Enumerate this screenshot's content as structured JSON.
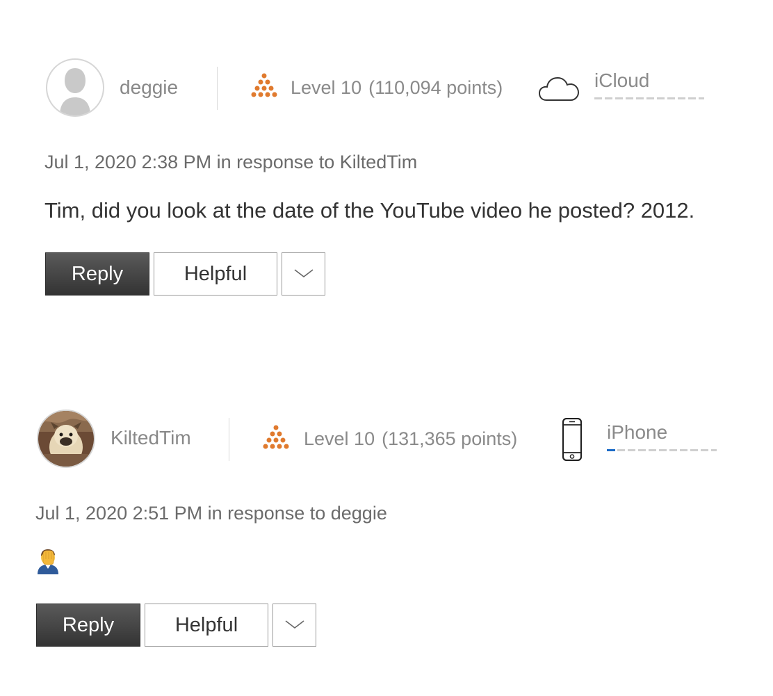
{
  "posts": [
    {
      "author": "deggie",
      "level": "Level 10",
      "points": "(110,094 points)",
      "community": "iCloud",
      "community_icon": "cloud-icon",
      "timestamp": "Jul 1, 2020 2:38 PM in response to KiltedTim",
      "body": "Tim, did you look at the date of the YouTube video he posted? 2012.",
      "reply_label": "Reply",
      "helpful_label": "Helpful"
    },
    {
      "author": "KiltedTim",
      "level": "Level 10",
      "points": "(131,365 points)",
      "community": "iPhone",
      "community_icon": "iphone-icon",
      "timestamp": "Jul 1, 2020 2:51 PM in response to deggie",
      "body_emoji": "person-facepalming-emoji",
      "reply_label": "Reply",
      "helpful_label": "Helpful"
    }
  ],
  "colors": {
    "level_orange": "#e07a2e",
    "reply_button": "#3c3c3c",
    "progress_blue": "#1b6bc7"
  }
}
